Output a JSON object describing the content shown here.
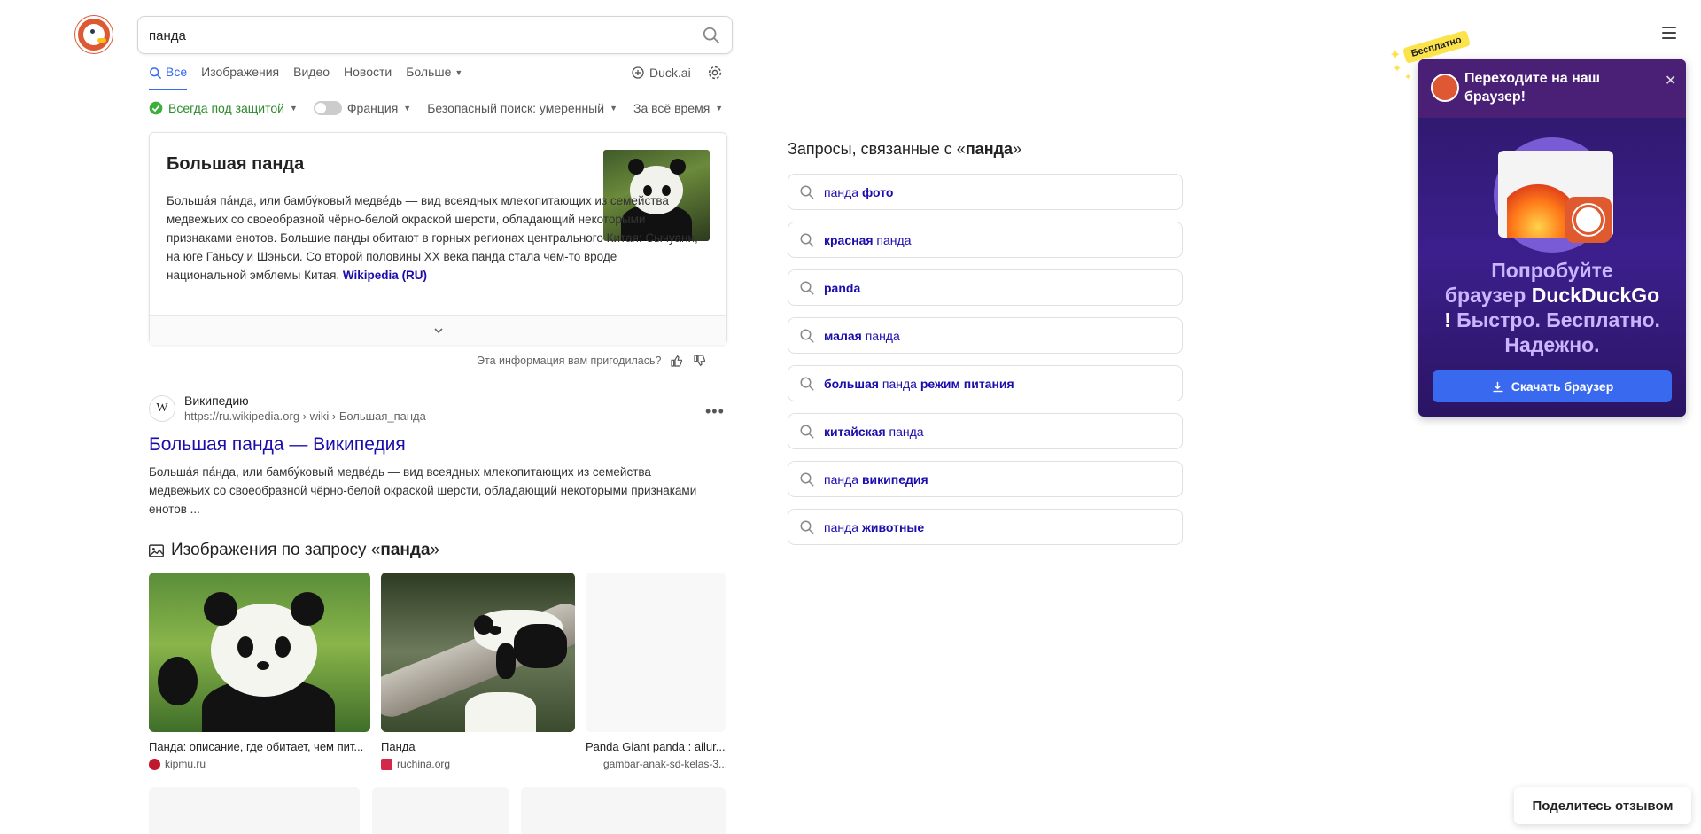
{
  "search": {
    "query": "панда"
  },
  "nav": {
    "tabs": [
      "Все",
      "Изображения",
      "Видео",
      "Новости",
      "Больше"
    ],
    "duckai": "Duck.ai"
  },
  "filters": {
    "protection": "Всегда под защитой",
    "region": "Франция",
    "safe_search": "Безопасный поиск: умеренный",
    "time": "За всё время"
  },
  "knowledge": {
    "title": "Большая панда",
    "text": "Больша́я па́нда, или бамбу́ковый медве́дь — вид всеядных млекопитающих из семейства медвежьих со своеобразной чёрно-белой окраской шерсти, обладающий некоторыми признаками енотов. Большие панды обитают в горных регионах центрального Китая: Сычуани, на юге Ганьсу и Шэньси. Со второй половины XX века панда стала чем-то вроде национальной эмблемы Китая.",
    "link": "Wikipedia (RU)",
    "feedback": "Эта информация вам пригодилась?"
  },
  "result": {
    "site": "Википедию",
    "url": "https://ru.wikipedia.org › wiki › Большая_панда",
    "title": "Большая панда — Википедия",
    "snippet": "Больша́я па́нда, или бамбу́ковый медве́дь — вид всеядных млекопитающих из семейства медвежьих со своеобразной чёрно-белой окраской шерсти, обладающий некоторыми признаками енотов ..."
  },
  "images": {
    "heading_prefix": "Изображения по запросу «",
    "heading_query": "панда",
    "heading_suffix": "»",
    "items": [
      {
        "caption": "Панда: описание, где обитает, чем пит...",
        "source": "kipmu.ru"
      },
      {
        "caption": "Панда",
        "source": "ruchina.org"
      },
      {
        "caption": "Panda Giant panda : ailur...",
        "source": "gambar-anak-sd-kelas-3..."
      }
    ]
  },
  "related": {
    "title_prefix": "Запросы, связанные с «",
    "title_query": "панда",
    "title_suffix": "»",
    "items": [
      {
        "plain1": "панда ",
        "bold": "фото",
        "plain2": ""
      },
      {
        "plain1": "",
        "bold": "красная",
        "plain2": " панда"
      },
      {
        "plain1": "panda",
        "bold": "",
        "plain2": ""
      },
      {
        "plain1": "",
        "bold": "малая",
        "plain2": " панда"
      },
      {
        "plain1": "",
        "bold": "большая",
        "plain2": " панда ",
        "bold2": "режим питания"
      },
      {
        "plain1": "",
        "bold": "китайская",
        "plain2": " панда"
      },
      {
        "plain1": "панда ",
        "bold": "википедия",
        "plain2": ""
      },
      {
        "plain1": "панда ",
        "bold": "животные",
        "plain2": ""
      }
    ]
  },
  "promo": {
    "badge": "Бесплатно",
    "header": "Переходите на наш браузер!",
    "line1": "Попробуйте",
    "line2_plain": "браузер ",
    "line2_bold": "DuckDuckGo",
    "line3_bold": "!",
    "line3_plain": " Быстро. Бесплатно. Надежно.",
    "button": "Скачать браузер"
  },
  "share_feedback": "Поделитесь отзывом",
  "colors": {
    "accent": "#3969ef",
    "link": "#1a0dab",
    "brand": "#de5833",
    "promo_bg": "#3c1f8c"
  }
}
